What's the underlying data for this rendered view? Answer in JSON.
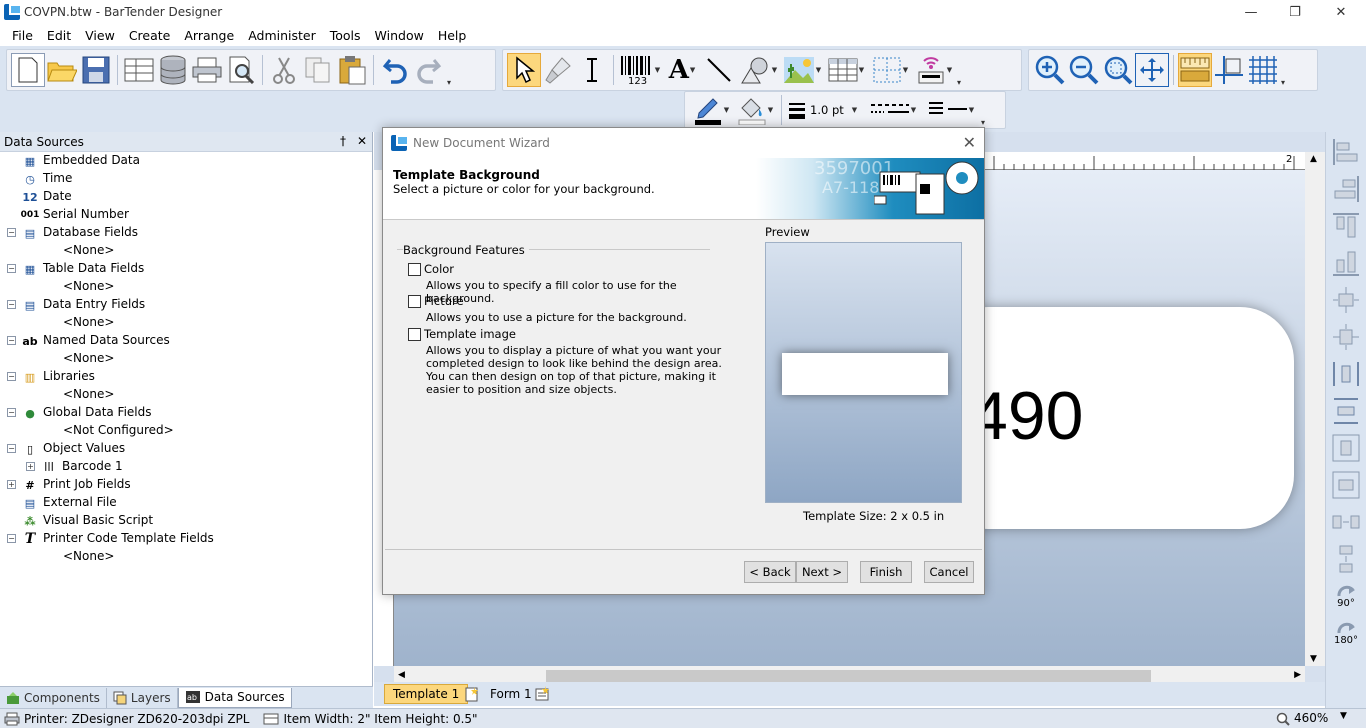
{
  "window": {
    "title": "COVPN.btw - BarTender Designer",
    "minimize": "—",
    "restore": "❐",
    "close": "✕"
  },
  "menu": [
    "File",
    "Edit",
    "View",
    "Create",
    "Arrange",
    "Administer",
    "Tools",
    "Window",
    "Help"
  ],
  "toolbar": {
    "line_width": "1.0 pt"
  },
  "data_sources": {
    "title": "Data Sources",
    "pin": "†",
    "close": "✕",
    "items": [
      {
        "label": "Embedded Data",
        "icon": "embedded-data-icon",
        "glyph": "▦"
      },
      {
        "label": "Time",
        "icon": "clock-icon",
        "glyph": "◷"
      },
      {
        "label": "Date",
        "icon": "calendar-icon",
        "glyph": "12"
      },
      {
        "label": "Serial Number",
        "icon": "serial-number-icon",
        "glyph": "001"
      },
      {
        "label": "Database Fields",
        "icon": "database-fields-icon",
        "glyph": "▤"
      },
      {
        "label": "<None>"
      },
      {
        "label": "Table Data Fields",
        "icon": "table-data-icon",
        "glyph": "▦"
      },
      {
        "label": "<None>"
      },
      {
        "label": "Data Entry Fields",
        "icon": "data-entry-icon",
        "glyph": "▤"
      },
      {
        "label": "<None>"
      },
      {
        "label": "Named Data Sources",
        "icon": "named-data-sources-icon",
        "glyph": "ab"
      },
      {
        "label": "<None>"
      },
      {
        "label": "Libraries",
        "icon": "libraries-icon",
        "glyph": "▥"
      },
      {
        "label": "<None>"
      },
      {
        "label": "Global Data Fields",
        "icon": "globe-icon",
        "glyph": "●"
      },
      {
        "label": "<Not Configured>"
      },
      {
        "label": "Object Values",
        "icon": "object-values-icon",
        "glyph": "▯"
      },
      {
        "label": "Barcode 1",
        "icon": "barcode-icon",
        "glyph": "|||"
      },
      {
        "label": "Print Job Fields",
        "icon": "print-job-icon",
        "glyph": "#"
      },
      {
        "label": "External File",
        "icon": "external-file-icon",
        "glyph": "▤"
      },
      {
        "label": "Visual Basic Script",
        "icon": "vb-script-icon",
        "glyph": "⁂"
      },
      {
        "label": "Printer Code Template Fields",
        "icon": "printer-code-icon",
        "glyph": "T"
      },
      {
        "label": "<None>"
      }
    ],
    "tabs": [
      "Components",
      "Layers",
      "Data Sources"
    ]
  },
  "design": {
    "label_text": "490",
    "ruler_mark": "2",
    "ruler_unit": "in",
    "page_tabs": [
      "Template 1",
      "Form 1"
    ]
  },
  "align_toolbar": {
    "rotate_90": "90°",
    "rotate_180": "180°"
  },
  "status": {
    "printer": "Printer: ZDesigner ZD620-203dpi ZPL",
    "item_size": "Item Width: 2\"  Item Height: 0.5\"",
    "zoom": "460%"
  },
  "wizard": {
    "title": "New Document Wizard",
    "heading": "Template Background",
    "subheading": "Select a picture or color for your background.",
    "group_label": "Background Features",
    "options": [
      {
        "label": "Color",
        "description": "Allows you to specify a fill color to use for the background.",
        "checked": false
      },
      {
        "label": "Picture",
        "description": "Allows you to use a picture for the background.",
        "checked": false
      },
      {
        "label": "Template image",
        "description": "Allows you to display a picture of what you want your completed design to look like behind the design area. You can then design on top of that picture, making it easier to position and size objects.",
        "checked": false
      }
    ],
    "preview_label": "Preview",
    "template_size": "Template Size:  2 x 0.5 in",
    "buttons": {
      "back": "< Back",
      "next": "Next >",
      "finish": "Finish",
      "cancel": "Cancel"
    },
    "banner_art_text": [
      "3597001",
      "A7-118"
    ]
  }
}
